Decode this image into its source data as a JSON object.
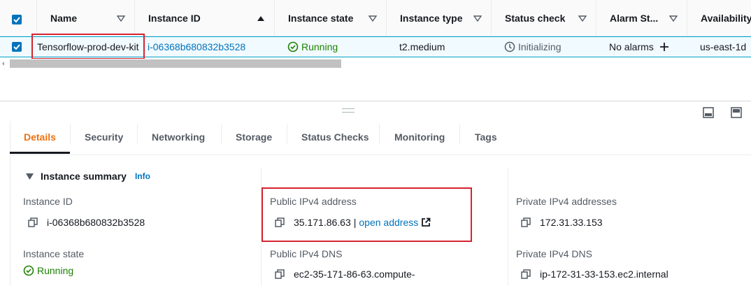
{
  "table": {
    "columns": [
      {
        "label": "Name"
      },
      {
        "label": "Instance ID"
      },
      {
        "label": "Instance state"
      },
      {
        "label": "Instance type"
      },
      {
        "label": "Status check"
      },
      {
        "label": "Alarm St..."
      },
      {
        "label": "Availability"
      }
    ],
    "row": {
      "name": "Tensorflow-prod-dev-kit",
      "instance_id": "i-06368b680832b3528",
      "state": "Running",
      "type": "t2.medium",
      "status_check": "Initializing",
      "alarm": "No alarms",
      "availability": "us-east-1d"
    }
  },
  "tabs": [
    {
      "label": "Details"
    },
    {
      "label": "Security"
    },
    {
      "label": "Networking"
    },
    {
      "label": "Storage"
    },
    {
      "label": "Status Checks"
    },
    {
      "label": "Monitoring"
    },
    {
      "label": "Tags"
    }
  ],
  "details": {
    "section_title": "Instance summary",
    "info": "Info",
    "instance_id_label": "Instance ID",
    "instance_id_value": "i-06368b680832b3528",
    "public_ipv4_label": "Public IPv4 address",
    "public_ipv4_value": "35.171.86.63",
    "ip_separator": "|",
    "open_address": "open address",
    "private_ipv4_label": "Private IPv4 addresses",
    "private_ipv4_value": "172.31.33.153",
    "instance_state_label": "Instance state",
    "instance_state_value": "Running",
    "public_dns_label": "Public IPv4 DNS",
    "public_dns_value": "ec2-35-171-86-63.compute-",
    "private_dns_label": "Private IPv4 DNS",
    "private_dns_value": "ip-172-31-33-153.ec2.internal"
  },
  "colors": {
    "link": "#0073bb",
    "running": "#1d8102",
    "active_tab": "#ec7211",
    "highlight_box": "#d5232f",
    "selected_row": "#f1faff"
  }
}
